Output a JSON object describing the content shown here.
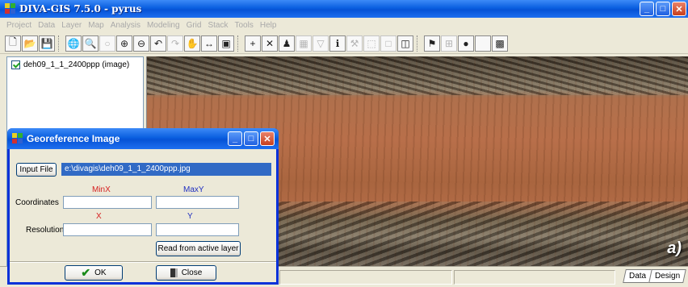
{
  "window": {
    "title": "DIVA-GIS 7.5.0 - pyrus",
    "controls": {
      "minimize": "_",
      "maximize": "□",
      "close": "✕"
    }
  },
  "menu": [
    "Project",
    "Data",
    "Layer",
    "Map",
    "Analysis",
    "Modeling",
    "Grid",
    "Stack",
    "Tools",
    "Help"
  ],
  "toolbar": {
    "groups": [
      [
        {
          "icon": "new-icon",
          "glyph": "🗋"
        },
        {
          "icon": "open-icon",
          "glyph": "📂"
        },
        {
          "icon": "save-icon",
          "glyph": "💾"
        }
      ],
      [
        {
          "icon": "globe-icon",
          "glyph": "🌐"
        },
        {
          "icon": "zoom-globe-icon",
          "glyph": "🔍"
        },
        {
          "icon": "pointer-icon",
          "glyph": "○",
          "disabled": true
        },
        {
          "icon": "zoom-in-icon",
          "glyph": "⊕"
        },
        {
          "icon": "zoom-out-icon",
          "glyph": "⊖"
        },
        {
          "icon": "undo-icon",
          "glyph": "↶"
        },
        {
          "icon": "redo-icon",
          "glyph": "↷",
          "disabled": true
        },
        {
          "icon": "pan-icon",
          "glyph": "✋"
        },
        {
          "icon": "full-extent-icon",
          "glyph": "↔"
        },
        {
          "icon": "zoom-layer-icon",
          "glyph": "▣"
        }
      ],
      [
        {
          "icon": "add-layer-icon",
          "glyph": "+"
        },
        {
          "icon": "remove-layer-icon",
          "glyph": "✕"
        },
        {
          "icon": "properties-icon",
          "glyph": "♟"
        },
        {
          "icon": "table-icon",
          "glyph": "▦",
          "disabled": true
        },
        {
          "icon": "filter-icon",
          "glyph": "▽",
          "disabled": true
        },
        {
          "icon": "info-icon",
          "glyph": "ℹ"
        },
        {
          "icon": "tools-icon",
          "glyph": "⚒",
          "disabled": true
        },
        {
          "icon": "select-icon",
          "glyph": "⬚",
          "disabled": true
        },
        {
          "icon": "clear-select-icon",
          "glyph": "□",
          "disabled": true
        },
        {
          "icon": "layer-select-icon",
          "glyph": "◫"
        }
      ],
      [
        {
          "icon": "flag-icon",
          "glyph": "⚑"
        },
        {
          "icon": "grid-icon",
          "glyph": "⊞",
          "disabled": true
        },
        {
          "icon": "record-icon",
          "glyph": "●"
        },
        {
          "icon": "blank-icon",
          "glyph": ""
        },
        {
          "icon": "map-icon",
          "glyph": "▩"
        }
      ]
    ]
  },
  "layers": [
    {
      "name": "deh09_1_1_2400ppp (image)",
      "checked": true
    }
  ],
  "map": {
    "label": "a)"
  },
  "statusbar": {
    "tabs": [
      "Data",
      "Design"
    ]
  },
  "dialog": {
    "title": "Georeference Image",
    "input_file_button": "Input File",
    "input_file_value": "e:\\divagis\\deh09_1_1_2400ppp.jpg",
    "coordinates_label": "Coordinates",
    "resolution_label": "Resolution",
    "minx_label": "MinX",
    "maxy_label": "MaxY",
    "x_label": "X",
    "y_label": "Y",
    "minx_value": "",
    "maxy_value": "",
    "x_value": "",
    "y_value": "",
    "read_button": "Read from active layer",
    "ok_button": "OK",
    "close_button": "Close"
  }
}
